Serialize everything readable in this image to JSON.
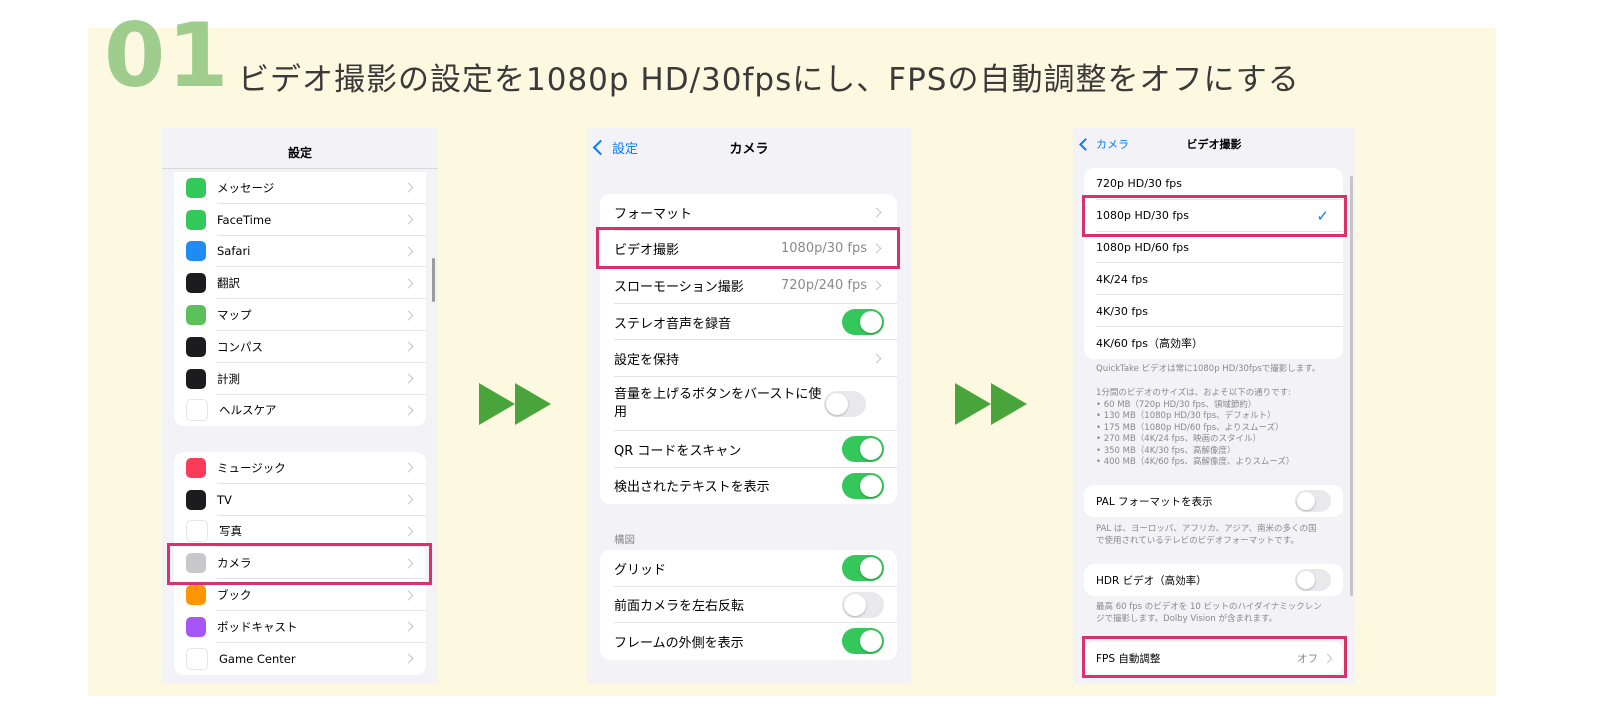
{
  "step_number": "01",
  "headline": "ビデオ撮影の設定を1080p HD/30fpsにし、FPSの自動調整をオフにする",
  "screen1": {
    "title": "設定",
    "group1": [
      {
        "label": "メッセージ",
        "icon": "messages-icon",
        "color": "#34c759"
      },
      {
        "label": "FaceTime",
        "icon": "facetime-icon",
        "color": "#34c759"
      },
      {
        "label": "Safari",
        "icon": "safari-icon",
        "color": "#1e8cf2"
      },
      {
        "label": "翻訳",
        "icon": "translate-icon",
        "color": "#1c1c1e"
      },
      {
        "label": "マップ",
        "icon": "maps-icon",
        "color": "#5ac05a"
      },
      {
        "label": "コンパス",
        "icon": "compass-icon",
        "color": "#1c1c1e"
      },
      {
        "label": "計測",
        "icon": "measure-icon",
        "color": "#1c1c1e"
      },
      {
        "label": "ヘルスケア",
        "icon": "health-icon",
        "color": "#ffffff"
      }
    ],
    "group2": [
      {
        "label": "ミュージック",
        "icon": "music-icon",
        "color": "#fa3c5a"
      },
      {
        "label": "TV",
        "icon": "tv-icon",
        "color": "#1c1c1e"
      },
      {
        "label": "写真",
        "icon": "photos-icon",
        "color": "#ffffff"
      },
      {
        "label": "カメラ",
        "icon": "camera-icon",
        "color": "#c7c7cc"
      },
      {
        "label": "ブック",
        "icon": "books-icon",
        "color": "#ff9500"
      },
      {
        "label": "ポッドキャスト",
        "icon": "podcasts-icon",
        "color": "#a855f7"
      },
      {
        "label": "Game Center",
        "icon": "game-center-icon",
        "color": "#ffffff"
      }
    ]
  },
  "screen2": {
    "back_label": "設定",
    "title": "カメラ",
    "group1": [
      {
        "label": "フォーマット",
        "type": "chevron",
        "value": ""
      },
      {
        "label": "ビデオ撮影",
        "type": "chevron",
        "value": "1080p/30 fps"
      },
      {
        "label": "スローモーション撮影",
        "type": "chevron",
        "value": "720p/240 fps"
      },
      {
        "label": "ステレオ音声を録音",
        "type": "toggle",
        "on": true
      },
      {
        "label": "設定を保持",
        "type": "chevron",
        "value": ""
      },
      {
        "label": "音量を上げるボタンをバーストに使用",
        "type": "toggle",
        "on": false
      },
      {
        "label": "QR コードをスキャン",
        "type": "toggle",
        "on": true
      },
      {
        "label": "検出されたテキストを表示",
        "type": "toggle",
        "on": true
      }
    ],
    "section_header": "構図",
    "group2": [
      {
        "label": "グリッド",
        "type": "toggle",
        "on": true
      },
      {
        "label": "前面カメラを左右反転",
        "type": "toggle",
        "on": false
      },
      {
        "label": "フレームの外側を表示",
        "type": "toggle",
        "on": true
      }
    ]
  },
  "screen3": {
    "back_label": "カメラ",
    "title": "ビデオ撮影",
    "options": [
      {
        "label": "720p HD/30 fps",
        "selected": false
      },
      {
        "label": "1080p HD/30 fps",
        "selected": true
      },
      {
        "label": "1080p HD/60 fps",
        "selected": false
      },
      {
        "label": "4K/24 fps",
        "selected": false
      },
      {
        "label": "4K/30 fps",
        "selected": false
      },
      {
        "label": "4K/60 fps（高効率）",
        "selected": false
      }
    ],
    "check_mark": "✓",
    "note1": "QuickTake ビデオは常に1080p HD/30fpsで撮影します。",
    "note2_lines": [
      "1分間のビデオのサイズは、およそ以下の通りです:",
      "• 60 MB（720p HD/30 fps、領域節約）",
      "• 130 MB（1080p HD/30 fps、デフォルト）",
      "• 175 MB（1080p HD/60 fps、よりスムーズ）",
      "• 270 MB（4K/24 fps、映画のスタイル）",
      "• 350 MB（4K/30 fps、高解像度）",
      "• 400 MB（4K/60 fps、高解像度、よりスムーズ）"
    ],
    "pal_label": "PAL フォーマットを表示",
    "pal_on": false,
    "pal_note_lines": [
      "PAL は、ヨーロッパ、アフリカ、アジア、南米の多くの国",
      "で使用されているテレビのビデオフォーマットです。"
    ],
    "hdr_label": "HDR ビデオ（高効率）",
    "hdr_on": false,
    "hdr_note_lines": [
      "最高 60 fps のビデオを 10 ビットのハイダイナミックレン",
      "ジで撮影します。Dolby Vision が含まれます。"
    ],
    "fps_label": "FPS 自動調整",
    "fps_value": "オフ"
  },
  "colors": {
    "highlight": "#d6336c",
    "step_green": "#9ecd8e",
    "arrow_green": "#4aa43c",
    "panel_bg": "#fdf9e1",
    "ios_blue": "#0a7aff",
    "toggle_on": "#34c759"
  }
}
